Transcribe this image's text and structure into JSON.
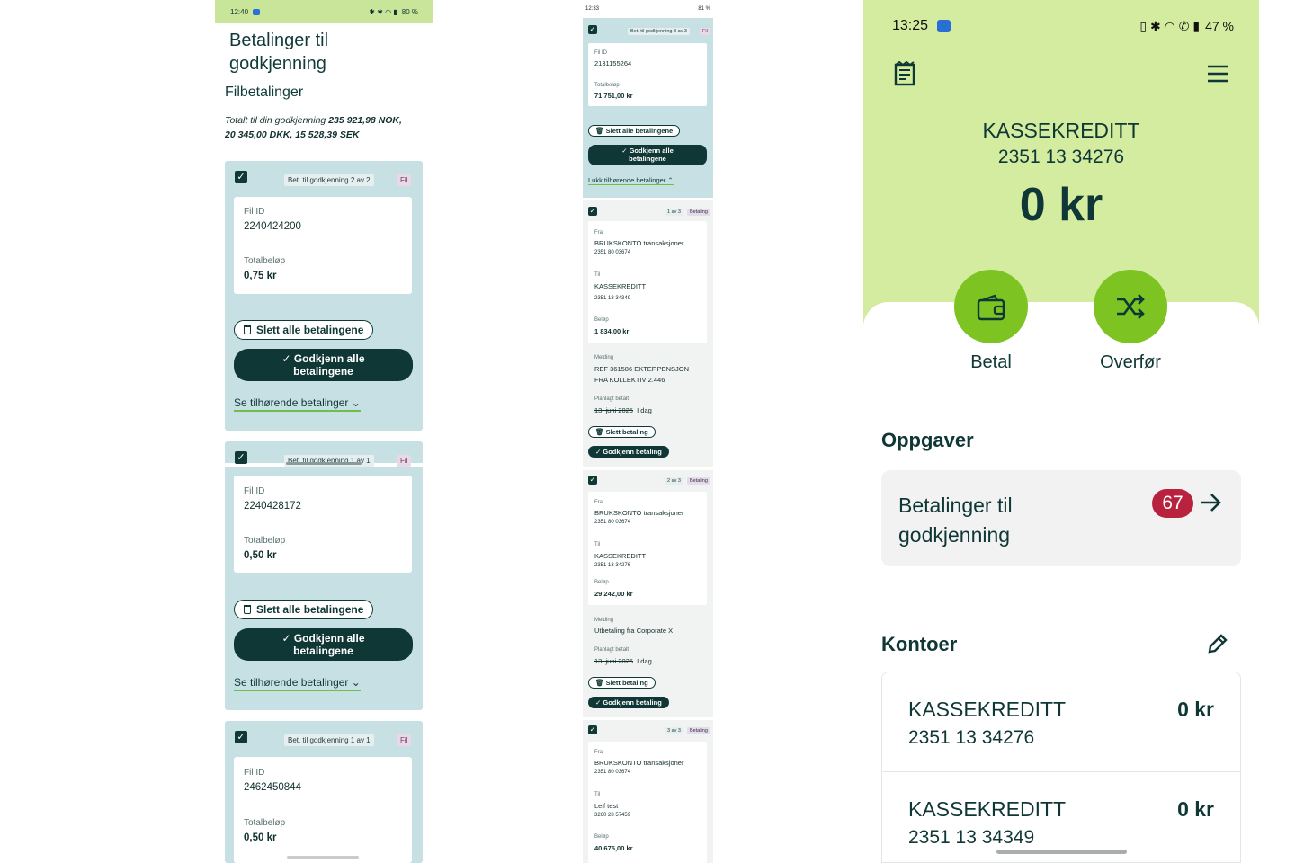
{
  "phone1": {
    "status": {
      "time": "12:40",
      "battery": "80 %"
    },
    "title_line1": "Betalinger til",
    "title_line2": "godkjenning",
    "subtitle": "Filbetalinger",
    "total_prefix": "Totalt til din godkjenning ",
    "total_line1_values": "235 921,98 NOK,",
    "total_line2_values": "20 345,00 DKK, 15 528,39 SEK",
    "cards": [
      {
        "badge": "Bet. til godkjenning 2 av 2",
        "type": "Fil",
        "fil_id_label": "Fil ID",
        "fil_id": "2240424200",
        "total_label": "Totalbeløp",
        "total": "0,75 kr",
        "delete_label": "Slett alle betalingene",
        "approve_line1": "✓ Godkjenn alle",
        "approve_line2": "betalingene",
        "see_label": "Se tilhørende betalinger"
      },
      {
        "badge": "Bet. til godkjenning 1 av 1",
        "type": "Fil",
        "fil_id_label": "Fil ID",
        "fil_id": "2240428172",
        "total_label": "Totalbeløp",
        "total": "0,50 kr",
        "delete_label": "Slett alle betalingene",
        "approve_line1": "✓ Godkjenn alle",
        "approve_line2": "betalingene",
        "see_label": "Se tilhørende betalinger"
      },
      {
        "badge": "Bet. til godkjenning 1 av 1",
        "type": "Fil",
        "fil_id_label": "Fil ID",
        "fil_id": "2462450844",
        "total_label": "Totalbeløp",
        "total": "0,50 kr"
      }
    ]
  },
  "phone2": {
    "status": {
      "time": "12:33",
      "battery": "81 %"
    },
    "file_card": {
      "badge": "Bet. til godkjenning 3 av 3",
      "type": "Fil",
      "fil_id_label": "Fil ID",
      "fil_id": "2131155264",
      "total_label": "Totalbeløp",
      "total": "71 751,00 kr",
      "delete_label": "Slett alle betalingene",
      "approve_line1": "✓ Godkjenn alle",
      "approve_line2": "betalingene",
      "close_label": "Lukk tilhørende betalinger"
    },
    "payments": [
      {
        "badge": "1 av 3",
        "type": "Betaling",
        "from_label": "Fra",
        "from_name": "BRUKSKONTO transaksjoner",
        "from_account": "2351 80 03674",
        "to_label": "Til",
        "to_name": "KASSEKREDITT",
        "to_account": "2351 13 34349",
        "amount_label": "Beløp",
        "amount": "1 834,00 kr",
        "message_label": "Melding",
        "message_line1": "REF 361586 EKTEF.PENSJON",
        "message_line2": "FRA KOLLEKTIV 2.446",
        "planned_label": "Planlagt betalt",
        "planned_old": "13. juni 2025",
        "planned_new": "I dag",
        "delete_label": "Slett betaling",
        "approve_label": "✓ Godkjenn betaling"
      },
      {
        "badge": "2 av 3",
        "type": "Betaling",
        "from_label": "Fra",
        "from_name": "BRUKSKONTO transaksjoner",
        "from_account": "2351 80 03674",
        "to_label": "Til",
        "to_name": "KASSEKREDITT",
        "to_account": "2351 13 34276",
        "amount_label": "Beløp",
        "amount": "29 242,00 kr",
        "message_label": "Melding",
        "message_line1": "Utbetaling fra Corporate X",
        "planned_label": "Planlagt betalt",
        "planned_old": "13. juni 2025",
        "planned_new": "I dag",
        "delete_label": "Slett betaling",
        "approve_label": "✓ Godkjenn betaling"
      },
      {
        "badge": "3 av 3",
        "type": "Betaling",
        "from_label": "Fra",
        "from_name": "BRUKSKONTO transaksjoner",
        "from_account": "2351 80 03674",
        "to_label": "Til",
        "to_name": "Leif test",
        "to_account": "3260 28 57459",
        "amount_label": "Beløp",
        "amount": "40 675,00 kr"
      }
    ]
  },
  "phone3": {
    "status": {
      "time": "13:25",
      "battery": "47 %"
    },
    "account_name": "KASSEKREDITT",
    "account_number": "2351 13 34276",
    "balance": "0 kr",
    "actions": {
      "pay": "Betal",
      "transfer": "Overfør"
    },
    "tasks_heading": "Oppgaver",
    "task": {
      "line1": "Betalinger til",
      "line2": "godkjenning",
      "count": "67"
    },
    "accounts_heading": "Kontoer",
    "accounts": [
      {
        "name": "KASSEKREDITT",
        "number": "2351 13 34276",
        "balance": "0 kr"
      },
      {
        "name": "KASSEKREDITT",
        "number": "2351 13 34349",
        "balance": "0 kr"
      }
    ],
    "colors": {
      "hero": "#d4eca0",
      "action": "#7dc321",
      "badge": "#b8223f",
      "text": "#0f3735"
    }
  }
}
